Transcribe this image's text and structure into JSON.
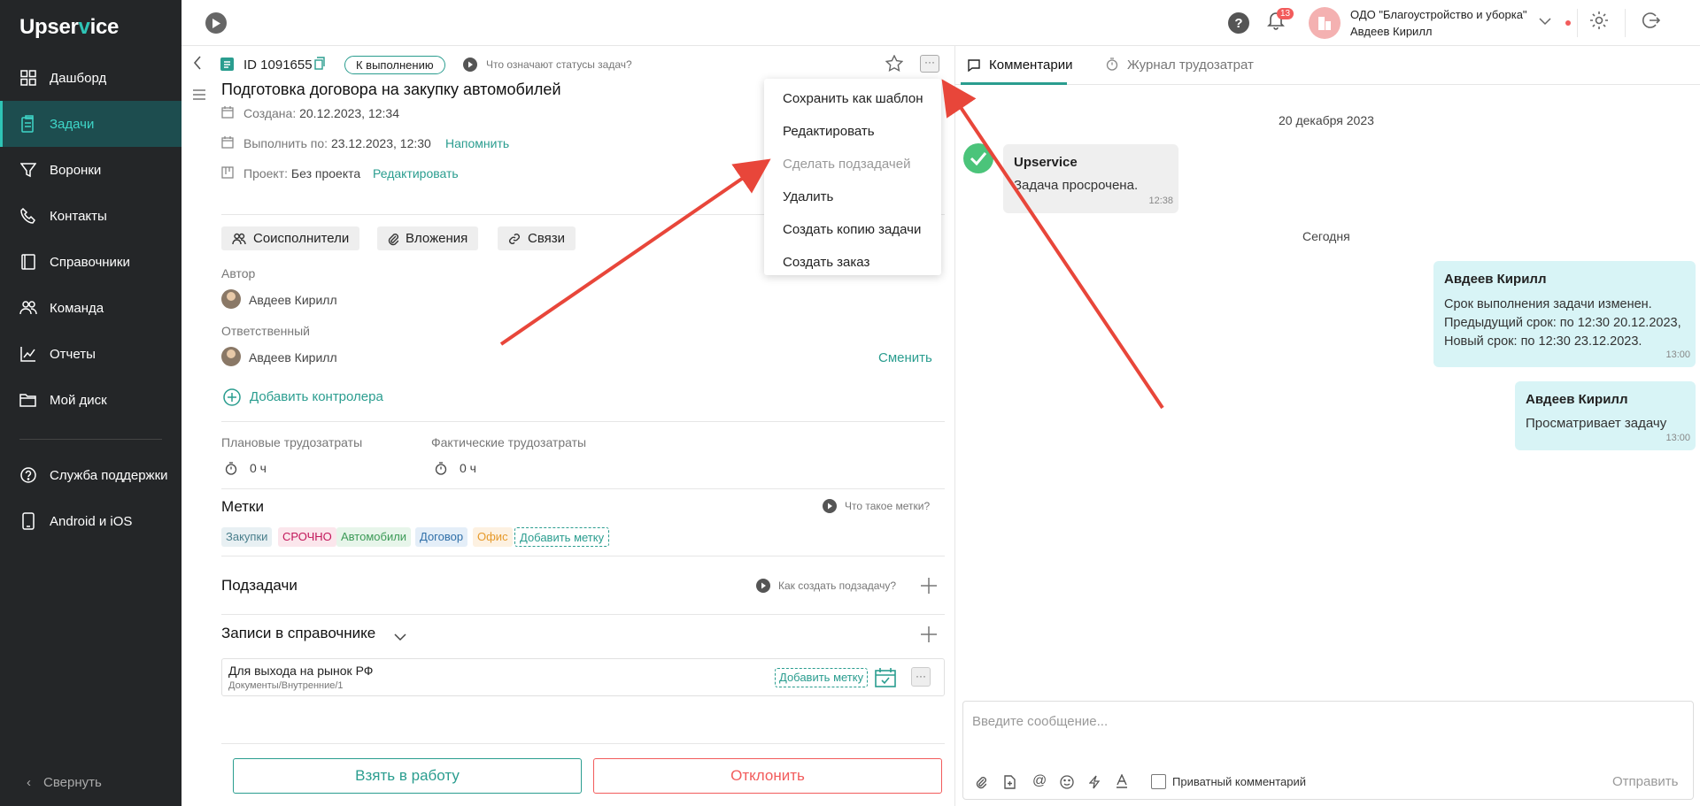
{
  "brand": {
    "name_a": "Upser",
    "name_v": "v",
    "name_b": "ice"
  },
  "nav": {
    "items": [
      {
        "label": "Дашборд",
        "icon": "dashboard-icon"
      },
      {
        "label": "Задачи",
        "icon": "tasks-icon",
        "active": true
      },
      {
        "label": "Воронки",
        "icon": "funnel-icon"
      },
      {
        "label": "Контакты",
        "icon": "contacts-icon"
      },
      {
        "label": "Справочники",
        "icon": "book-icon"
      },
      {
        "label": "Команда",
        "icon": "team-icon"
      },
      {
        "label": "Отчеты",
        "icon": "chart-icon"
      },
      {
        "label": "Мой диск",
        "icon": "folder-icon"
      }
    ],
    "bottom": [
      {
        "label": "Служба поддержки",
        "icon": "help-circle-icon"
      },
      {
        "label": "Android и iOS",
        "icon": "phone-icon"
      }
    ],
    "collapse": "Свернуть"
  },
  "topbar": {
    "notifications": "13",
    "org": "ОДО \"Благоустройство и уборка\"",
    "user": "Авдеев Кирилл"
  },
  "task": {
    "id": "ID 1091655",
    "status": "К выполнению",
    "status_help": "Что означают статусы задач?",
    "title": "Подготовка договора на закупку автомобилей",
    "created_label": "Создана:",
    "created": "20.12.2023, 12:34",
    "due_label": "Выполнить по:",
    "due": "23.12.2023, 12:30",
    "remind": "Напомнить",
    "project_label": "Проект:",
    "project": "Без проекта",
    "project_edit": "Редактировать",
    "tabs": [
      "Соисполнители",
      "Вложения",
      "Связи"
    ],
    "author_label": "Автор",
    "author": "Авдеев Кирилл",
    "resp_label": "Ответственный",
    "resp": "Авдеев Кирилл",
    "change": "Сменить",
    "add_controller": "Добавить контролера",
    "plan_label": "Плановые трудозатраты",
    "plan": "0 ч",
    "fact_label": "Фактические трудозатраты",
    "fact": "0 ч",
    "tags_title": "Метки",
    "tags_help": "Что такое метки?",
    "tags": [
      {
        "label": "Закупки",
        "bg": "#e8f0f3",
        "fg": "#4a7f8c"
      },
      {
        "label": "СРОЧНО",
        "bg": "#fbe6ec",
        "fg": "#c2185b"
      },
      {
        "label": "Автомобили",
        "bg": "#e7f5ea",
        "fg": "#3c9a57"
      },
      {
        "label": "Договор",
        "bg": "#e4eef8",
        "fg": "#2f6fa8"
      },
      {
        "label": "Офис",
        "bg": "#fdf1e1",
        "fg": "#e69a2b"
      }
    ],
    "add_tag": "Добавить метку",
    "subtasks_title": "Подзадачи",
    "subtasks_help": "Как создать подзадачу?",
    "records_title": "Записи в справочнике",
    "record": {
      "title": "Для выхода на рынок РФ",
      "path": "Документы/Внутренние/1",
      "add_tag": "Добавить метку"
    },
    "take": "Взять в работу",
    "reject": "Отклонить"
  },
  "menu": [
    "Сохранить как шаблон",
    "Редактировать",
    "Сделать подзадачей",
    "Удалить",
    "Создать копию задачи",
    "Создать заказ"
  ],
  "right": {
    "tab_comments": "Комментарии",
    "tab_log": "Журнал трудозатрат",
    "date1": "20 декабря 2023",
    "date2": "Сегодня",
    "sys_msg": {
      "author": "Upservice",
      "text": "Задача просрочена.",
      "time": "12:38"
    },
    "msg1": {
      "author": "Авдеев Кирилл",
      "l1": "Срок выполнения задачи изменен.",
      "l2": "Предыдущий срок: по 12:30 20.12.2023,",
      "l3": "Новый срок: по 12:30 23.12.2023.",
      "time": "13:00"
    },
    "msg2": {
      "author": "Авдеев Кирилл",
      "text": "Просматривает задачу",
      "time": "13:00"
    },
    "placeholder": "Введите сообщение...",
    "private": "Приватный комментарий",
    "send": "Отправить"
  },
  "colors": {
    "accent": "#2a9d8f",
    "danger": "#f25b5b",
    "arrow": "#e8463a"
  }
}
